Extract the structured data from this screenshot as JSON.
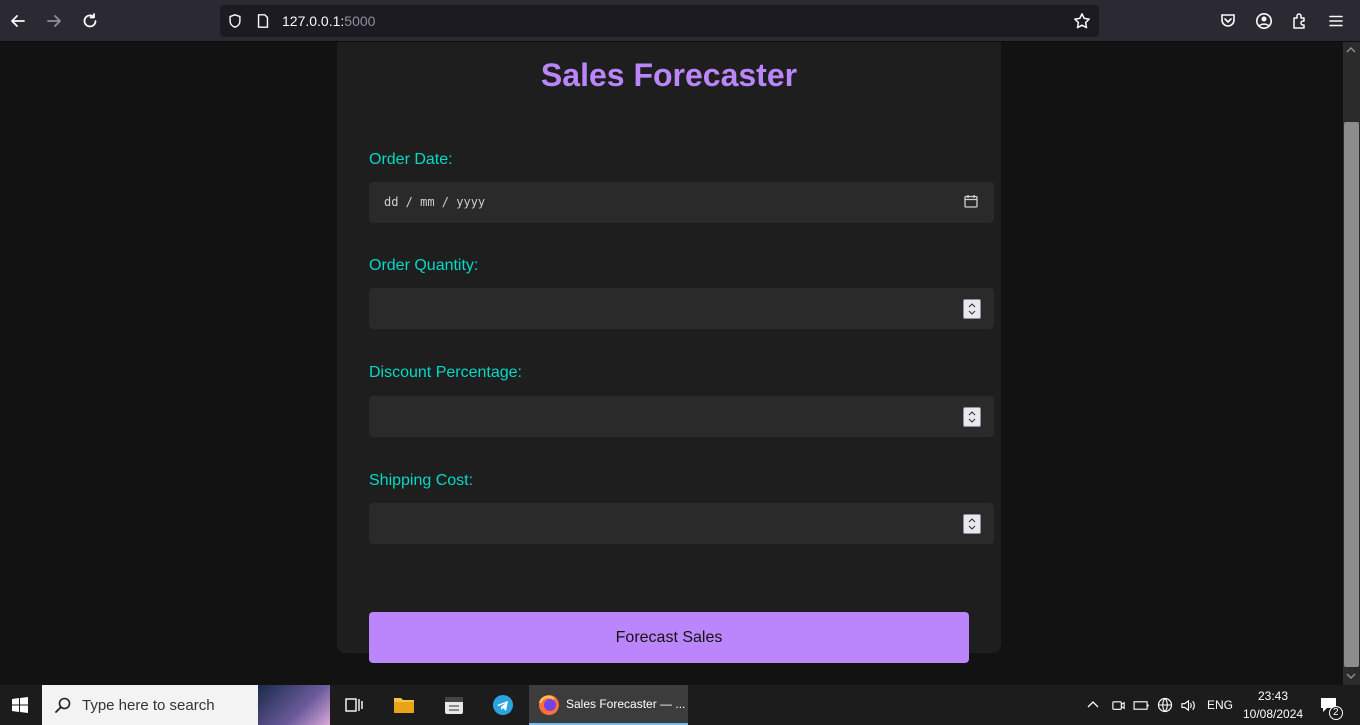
{
  "browser": {
    "url_host": "127.0.0.1:",
    "url_port": "5000"
  },
  "page": {
    "title": "Sales Forecaster",
    "fields": [
      {
        "label": "Order Date:",
        "type": "date",
        "placeholder": "dd / mm / yyyy"
      },
      {
        "label": "Order Quantity:",
        "type": "number",
        "value": ""
      },
      {
        "label": "Discount Percentage:",
        "type": "number",
        "value": ""
      },
      {
        "label": "Shipping Cost:",
        "type": "number",
        "value": ""
      }
    ],
    "submit_label": "Forecast Sales"
  },
  "taskbar": {
    "search_placeholder": "Type here to search",
    "firefox_task_label": "Sales Forecaster — ...",
    "language": "ENG",
    "time": "23:43",
    "date": "10/08/2024",
    "notification_count": "2"
  },
  "colors": {
    "accent": "#bb86fc",
    "label": "#03dac6",
    "background": "#121212",
    "card": "#1e1e1e"
  }
}
